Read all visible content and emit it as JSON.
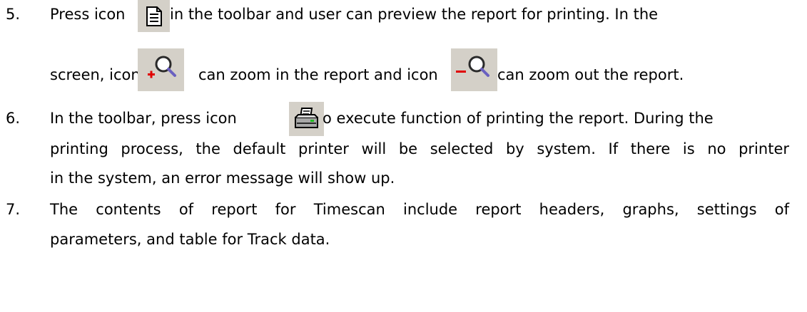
{
  "items": [
    {
      "number": "5.",
      "line1_before_icon": "Press icon",
      "line1_after_icon": "in the toolbar and user can preview the report for printing. In the",
      "line2_before_zoomin": "screen, icon",
      "line2_between": "can zoom in the report and icon",
      "line2_after_zoomout": "can zoom out the report."
    },
    {
      "number": "6.",
      "line1_before_icon": "In the toolbar, press icon",
      "line1_after_icon": "o execute function of printing the report. During the",
      "line2": "printing process, the default printer will be selected by system. If there is no printer",
      "line3": "in the system, an error message will show up."
    },
    {
      "number": "7.",
      "line1": "The contents of report for Timescan include report headers, graphs, settings of",
      "line2": "parameters, and table for Track data."
    }
  ],
  "icons": {
    "preview": "document-preview-icon",
    "zoom_in": "zoom-in-icon",
    "zoom_out": "zoom-out-icon",
    "print": "printer-icon"
  },
  "colors": {
    "icon_background": "#d4d0c8",
    "plus_sign": "#e00000",
    "minus_sign": "#e00000",
    "printer_led": "#20c020"
  }
}
